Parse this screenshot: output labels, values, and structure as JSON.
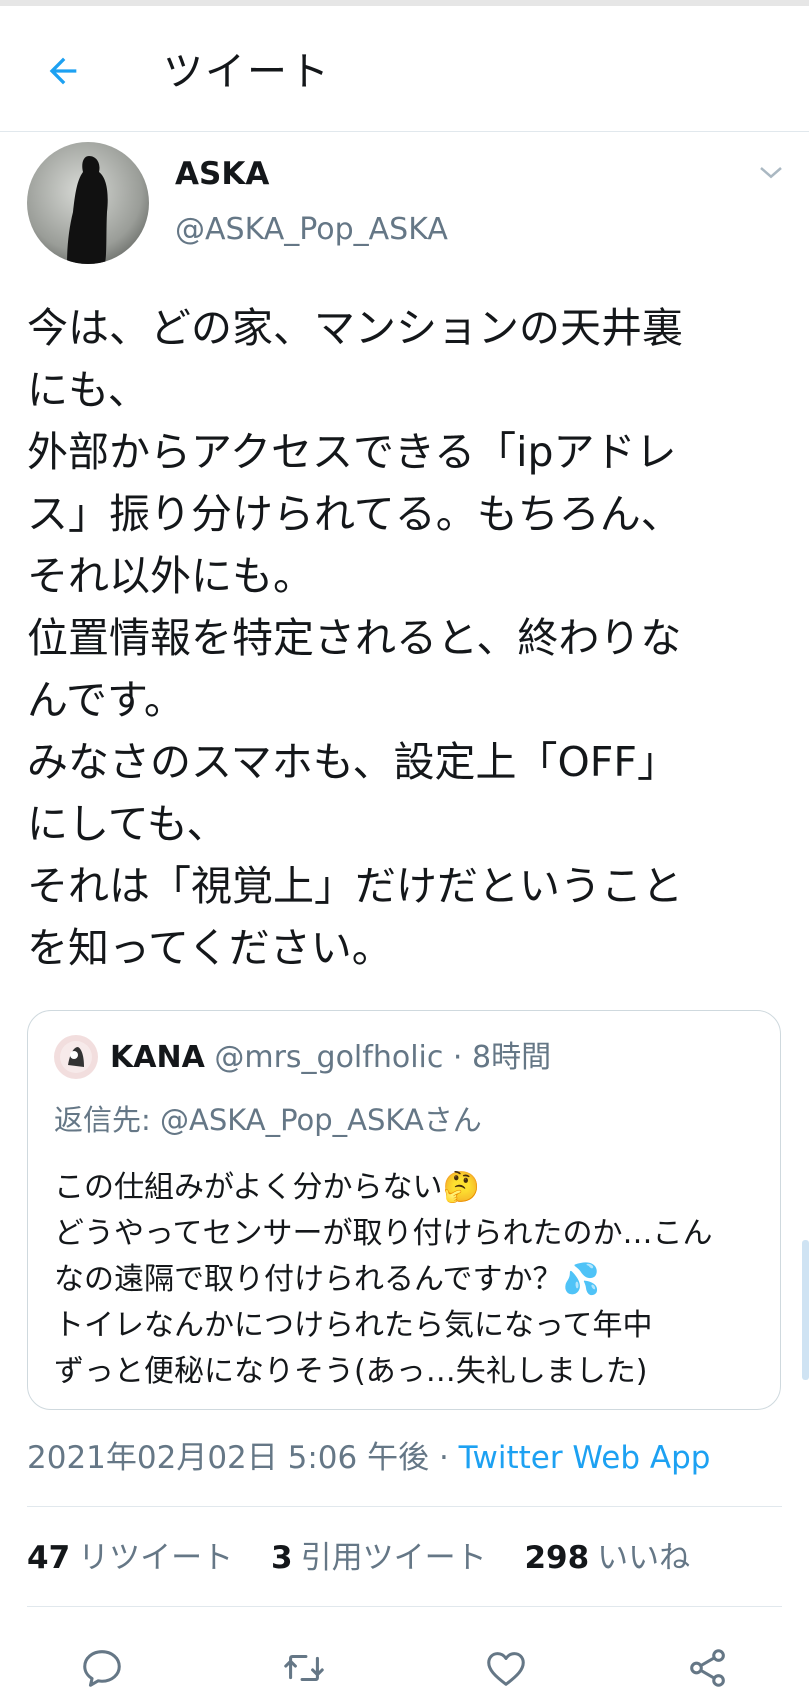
{
  "header": {
    "title": "ツイート",
    "back_icon": "arrow-left-icon"
  },
  "tweet": {
    "author_name": "ASKA",
    "author_handle": "@ASKA_Pop_ASKA",
    "text": "今は、どの家、マンションの天井裏\nにも、\n外部からアクセスできる「ipアドレ\nス」振り分けられてる。もちろん、\nそれ以外にも。\n位置情報を特定されると、終わりな\nんです。\nみなさのスマホも、設定上「OFF」\nにしても、\nそれは「視覚上」だけだということ\nを知ってください。"
  },
  "quote": {
    "name": "KANA",
    "handle": "@mrs_golfholic",
    "time": "· 8時間",
    "reply_to": "返信先: @ASKA_Pop_ASKAさん",
    "text": "この仕組みがよく分からない🤔\nどうやってセンサーが取り付けられたのか…こん\nなの遠隔で取り付けられるんですか？💦\nトイレなんかにつけられたら気になって年中\nずっと便秘になりそう(あっ…失礼しました)"
  },
  "meta": {
    "timestamp": "2021年02月02日 5:06 午後 · ",
    "source": "Twitter Web App"
  },
  "stats": {
    "retweets_count": "47",
    "retweets_label": "リツイート",
    "quotes_count": "3",
    "quotes_label": "引用ツイート",
    "likes_count": "298",
    "likes_label": "いいね"
  },
  "actions": [
    "reply-icon",
    "retweet-icon",
    "like-icon",
    "share-icon"
  ],
  "colors": {
    "accent": "#1da1f2",
    "secondary_text": "#657786",
    "border": "#e1e8ed"
  }
}
